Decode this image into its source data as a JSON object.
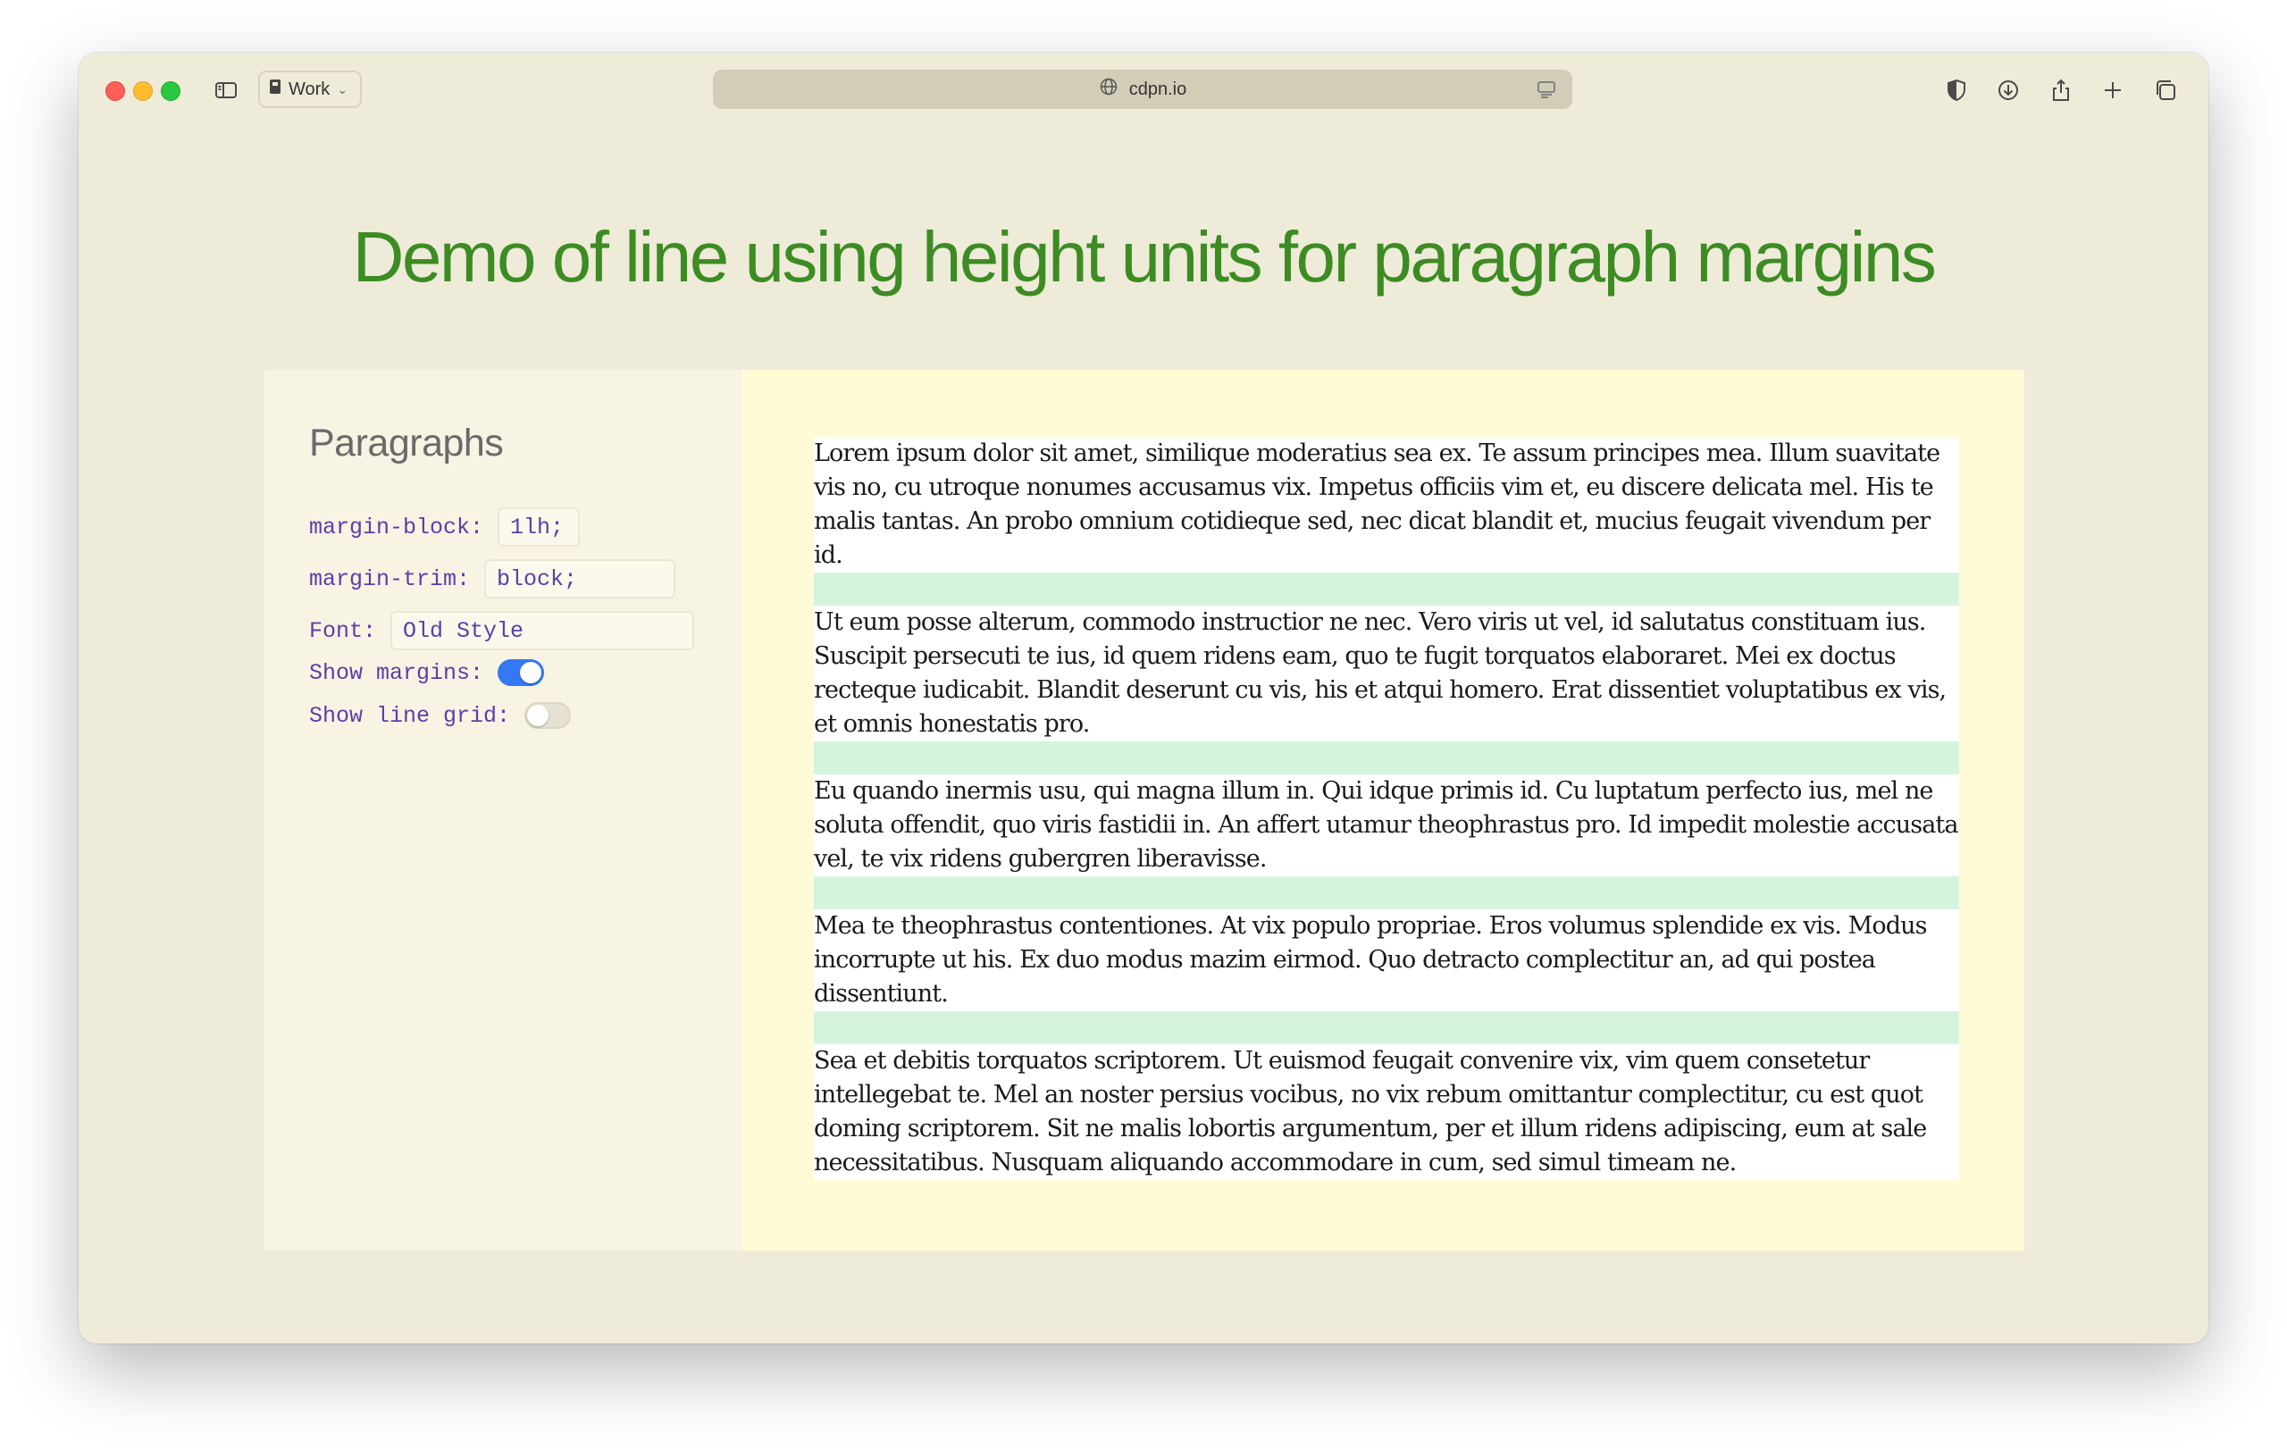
{
  "browser": {
    "profile_label": "Work",
    "url": "cdpn.io"
  },
  "page": {
    "title": "Demo of line using height units for paragraph margins"
  },
  "sidebar": {
    "heading": "Paragraphs",
    "controls": {
      "margin_block": {
        "label": "margin-block:",
        "value": "1lh;"
      },
      "margin_trim": {
        "label": "margin-trim:",
        "value": "block;"
      },
      "font": {
        "label": "Font:",
        "value": "Old Style"
      },
      "show_margins": {
        "label": "Show margins:",
        "checked": true
      },
      "show_line_grid": {
        "label": "Show line grid:",
        "checked": false
      }
    }
  },
  "content": {
    "paragraphs": [
      "Lorem ipsum dolor sit amet, similique moderatius sea ex. Te assum principes mea. Illum suavitate vis no, cu utroque nonumes accusamus vix. Impetus officiis vim et, eu discere delicata mel. His te malis tantas. An probo omnium cotidieque sed, nec dicat blandit et, mucius feugait vivendum per id.",
      "Ut eum posse alterum, commodo instructior ne nec. Vero viris ut vel, id salutatus constituam ius. Suscipit persecuti te ius, id quem ridens eam, quo te fugit torquatos elaboraret. Mei ex doctus recteque iudicabit. Blandit deserunt cu vis, his et atqui homero. Erat dissentiet voluptatibus ex vis, et omnis honestatis pro.",
      "Eu quando inermis usu, qui magna illum in. Qui idque primis id. Cu luptatum perfecto ius, mel ne soluta offendit, quo viris fastidii in. An affert utamur theophrastus pro. Id impedit molestie accusata vel, te vix ridens gubergren liberavisse.",
      "Mea te theophrastus contentiones. At vix populo propriae. Eros volumus splendide ex vis. Modus incorrupte ut his. Ex duo modus mazim eirmod. Quo detracto complectitur an, ad qui postea dissentiunt.",
      "Sea et debitis torquatos scriptorem. Ut euismod feugait convenire vix, vim quem consetetur intellegebat te. Mel an noster persius vocibus, no vix rebum omittantur complectitur, cu est quot doming scriptorem. Sit ne malis lobortis argumentum, per et illum ridens adipiscing, eum at sale necessitatibus. Nusquam aliquando accommodare in cum, sed simul timeam ne."
    ]
  },
  "colors": {
    "title": "#3c8c23",
    "code": "#5b3fa8",
    "margin_highlight": "#d4f5dc",
    "toggle_on": "#3478f6"
  }
}
